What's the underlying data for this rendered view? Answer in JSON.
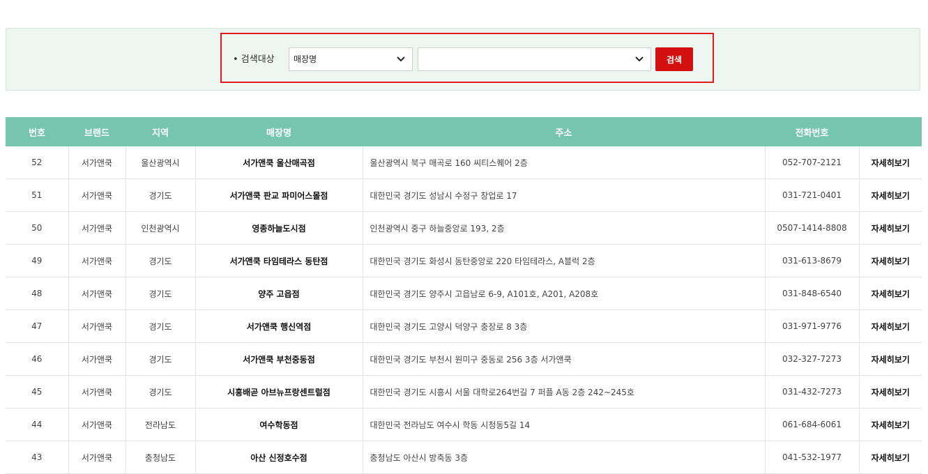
{
  "search": {
    "label": "• 검색대상",
    "target_select_value": "매장명",
    "value_select_value": "",
    "button_label": "검색"
  },
  "table": {
    "headers": [
      "번호",
      "브랜드",
      "지역",
      "매장명",
      "주소",
      "전화번호",
      ""
    ],
    "rows": [
      {
        "no": "52",
        "brand": "서가앤쿡",
        "region": "울산광역시",
        "store": "서가앤쿡 울산매곡점",
        "address": "울산광역시 북구 매곡로 160 씨티스퀘어 2층",
        "phone": "052-707-2121",
        "detail": "자세히보기"
      },
      {
        "no": "51",
        "brand": "서가앤쿡",
        "region": "경기도",
        "store": "서가앤쿡 판교 파미어스몰점",
        "address": "대한민국 경기도 성남시 수정구 창업로 17",
        "phone": "031-721-0401",
        "detail": "자세히보기"
      },
      {
        "no": "50",
        "brand": "서가앤쿡",
        "region": "인천광역시",
        "store": "영종하늘도시점",
        "address": "인천광역시 중구 하늘중앙로 193, 2층",
        "phone": "0507-1414-8808",
        "detail": "자세히보기"
      },
      {
        "no": "49",
        "brand": "서가앤쿡",
        "region": "경기도",
        "store": "서가앤쿡 타임테라스 동탄점",
        "address": "대한민국 경기도 화성시 동탄중앙로 220 타임테라스, A블럭 2층",
        "phone": "031-613-8679",
        "detail": "자세히보기"
      },
      {
        "no": "48",
        "brand": "서가앤쿡",
        "region": "경기도",
        "store": "양주 고읍점",
        "address": "대한민국 경기도 양주시 고읍남로 6-9, A101호, A201, A208호",
        "phone": "031-848-6540",
        "detail": "자세히보기"
      },
      {
        "no": "47",
        "brand": "서가앤쿡",
        "region": "경기도",
        "store": "서가앤쿡 행신역점",
        "address": "대한민국 경기도 고양시 덕양구 충장로 8 3층",
        "phone": "031-971-9776",
        "detail": "자세히보기"
      },
      {
        "no": "46",
        "brand": "서가앤쿡",
        "region": "경기도",
        "store": "서가앤쿡 부천중동점",
        "address": "대한민국 경기도 부천시 원미구 중동로 256 3층 서가앤쿡",
        "phone": "032-327-7273",
        "detail": "자세히보기"
      },
      {
        "no": "45",
        "brand": "서가앤쿡",
        "region": "경기도",
        "store": "시흥배곧 아브뉴프랑센트럴점",
        "address": "대한민국 경기도 시흥시 서울 대학로264번길 7 퍼플 A동 2층 242~245호",
        "phone": "031-432-7273",
        "detail": "자세히보기"
      },
      {
        "no": "44",
        "brand": "서가앤쿡",
        "region": "전라남도",
        "store": "여수학동점",
        "address": "대한민국 전라남도 여수시 학동 시청동5길 14",
        "phone": "061-684-6061",
        "detail": "자세히보기"
      },
      {
        "no": "43",
        "brand": "서가앤쿡",
        "region": "충청남도",
        "store": "아산 신정호수점",
        "address": "충청남도 아산시 방축동 3층",
        "phone": "041-532-1977",
        "detail": "자세히보기"
      }
    ]
  },
  "colors": {
    "header_bg": "#76c5ad",
    "search_button": "#d30f0f",
    "search_highlight": "#e11b1b",
    "panel_bg": "#eef6f2"
  }
}
